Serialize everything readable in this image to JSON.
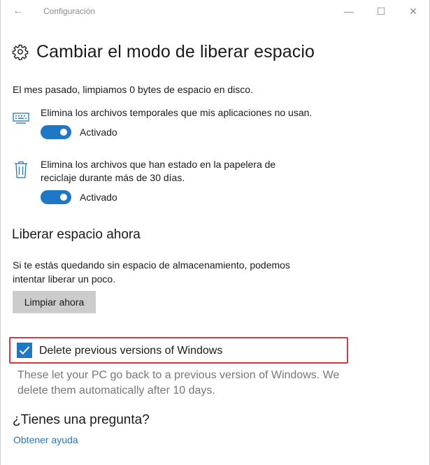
{
  "window": {
    "title": "Configuración",
    "back_glyph": "←",
    "minimize_glyph": "—",
    "maximize_glyph": "☐",
    "close_glyph": "✕"
  },
  "page": {
    "icon": "gear-icon",
    "title": "Cambiar el modo de liberar espacio"
  },
  "summary": "El mes pasado, limpiamos 0 bytes de espacio en disco.",
  "settings": [
    {
      "icon": "keyboard-icon",
      "label_lines": [
        "Elimina los archivos temporales que mis aplicaciones no usan."
      ],
      "toggle_state": "Activado",
      "enabled": true
    },
    {
      "icon": "trash-icon",
      "label_lines": [
        "Elimina los archivos que han estado en la papelera de",
        "reciclaje durante más de 30 días."
      ],
      "toggle_state": "Activado",
      "enabled": true
    }
  ],
  "free_now": {
    "heading": "Liberar espacio ahora",
    "text_lines": [
      "Si te estás quedando sin espacio de almacenamiento, podemos",
      "intentar liberar un poco."
    ],
    "button_label": "Limpiar ahora"
  },
  "previous_versions": {
    "checked": true,
    "label": "Delete previous versions of Windows",
    "description_lines": [
      "These let your PC go back to a previous version of Windows. We",
      "delete them automatically after 10 days."
    ]
  },
  "help": {
    "heading": "¿Tienes una pregunta?",
    "link_label": "Obtener ayuda"
  },
  "colors": {
    "accent": "#1e78c6",
    "highlight_border": "#d9363e",
    "muted_text": "#777777"
  }
}
